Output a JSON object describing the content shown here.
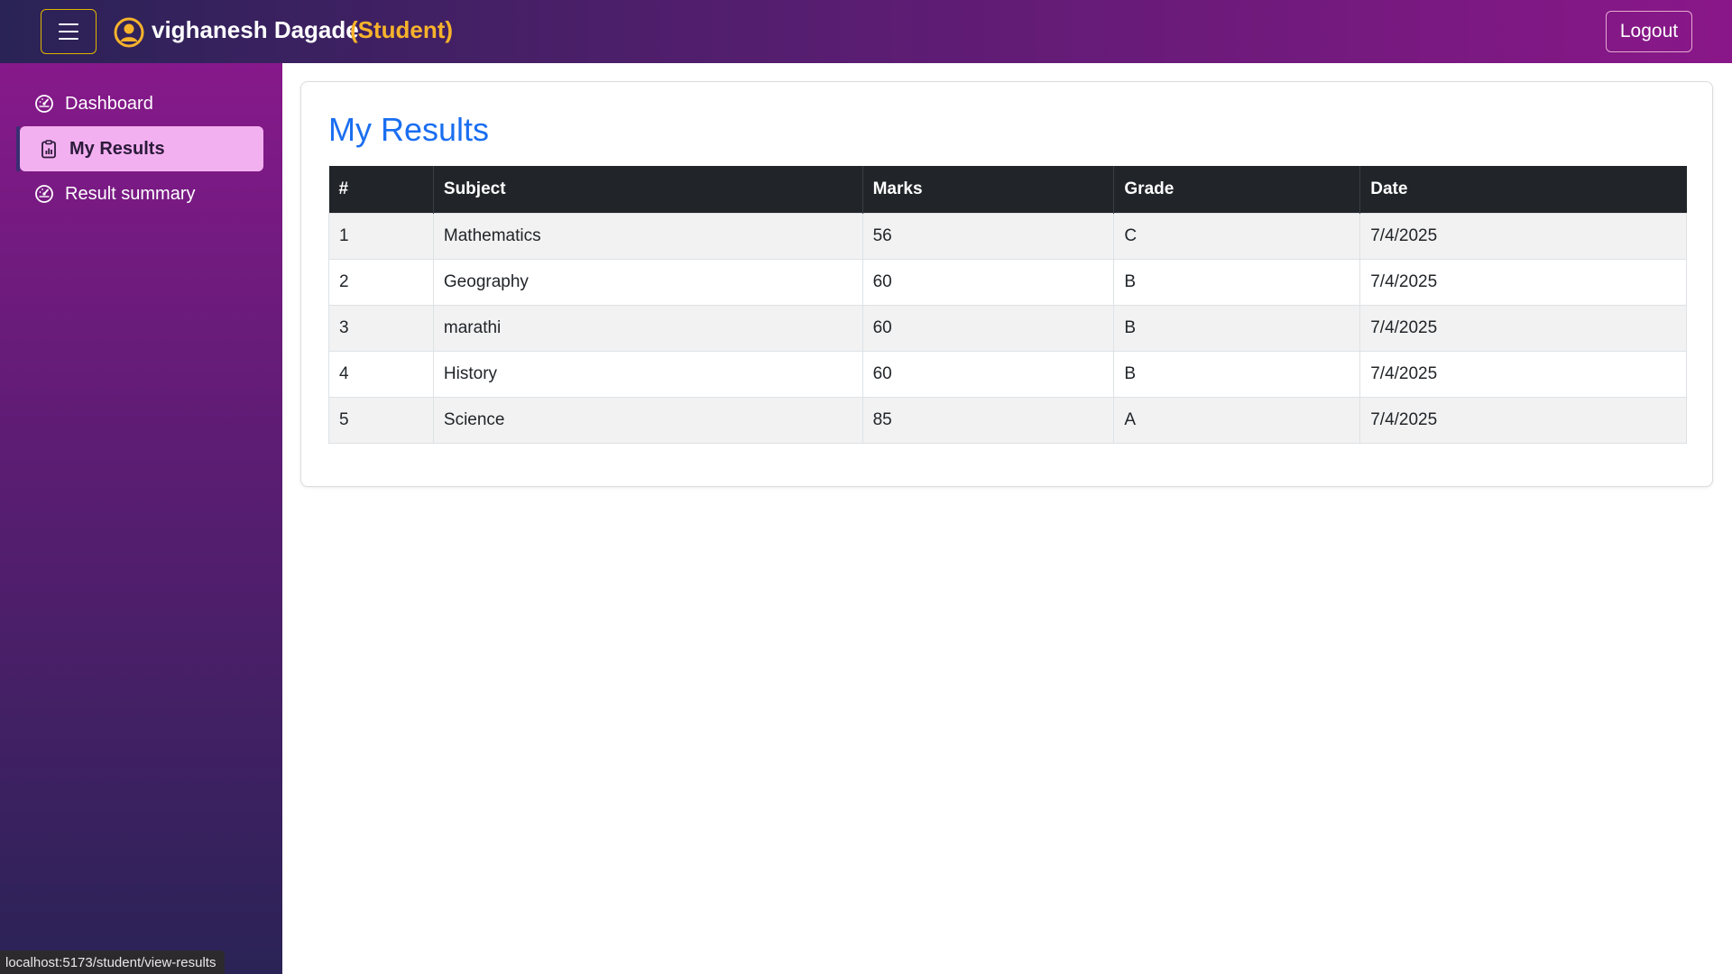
{
  "header": {
    "user_name": "vighanesh Dagade",
    "user_role": "(Student)",
    "logout_label": "Logout"
  },
  "sidebar": {
    "items": [
      {
        "label": "Dashboard",
        "icon": "dashboard-gauge-icon",
        "active": false
      },
      {
        "label": "My Results",
        "icon": "clipboard-chart-icon",
        "active": true
      },
      {
        "label": "Result summary",
        "icon": "dashboard-gauge-icon",
        "active": false
      }
    ]
  },
  "main": {
    "title": "My Results",
    "table": {
      "columns": [
        "#",
        "Subject",
        "Marks",
        "Grade",
        "Date"
      ],
      "rows": [
        [
          "1",
          "Mathematics",
          "56",
          "C",
          "7/4/2025"
        ],
        [
          "2",
          "Geography",
          "60",
          "B",
          "7/4/2025"
        ],
        [
          "3",
          "marathi",
          "60",
          "B",
          "7/4/2025"
        ],
        [
          "4",
          "History",
          "60",
          "B",
          "7/4/2025"
        ],
        [
          "5",
          "Science",
          "85",
          "A",
          "7/4/2025"
        ]
      ]
    }
  },
  "status_bar": {
    "url": "localhost:5173/student/view-results"
  },
  "colors": {
    "accent_title": "#1a6ef0",
    "role_highlight": "#f7b32b",
    "active_nav": "#f3b0f0",
    "table_header": "#212529"
  }
}
